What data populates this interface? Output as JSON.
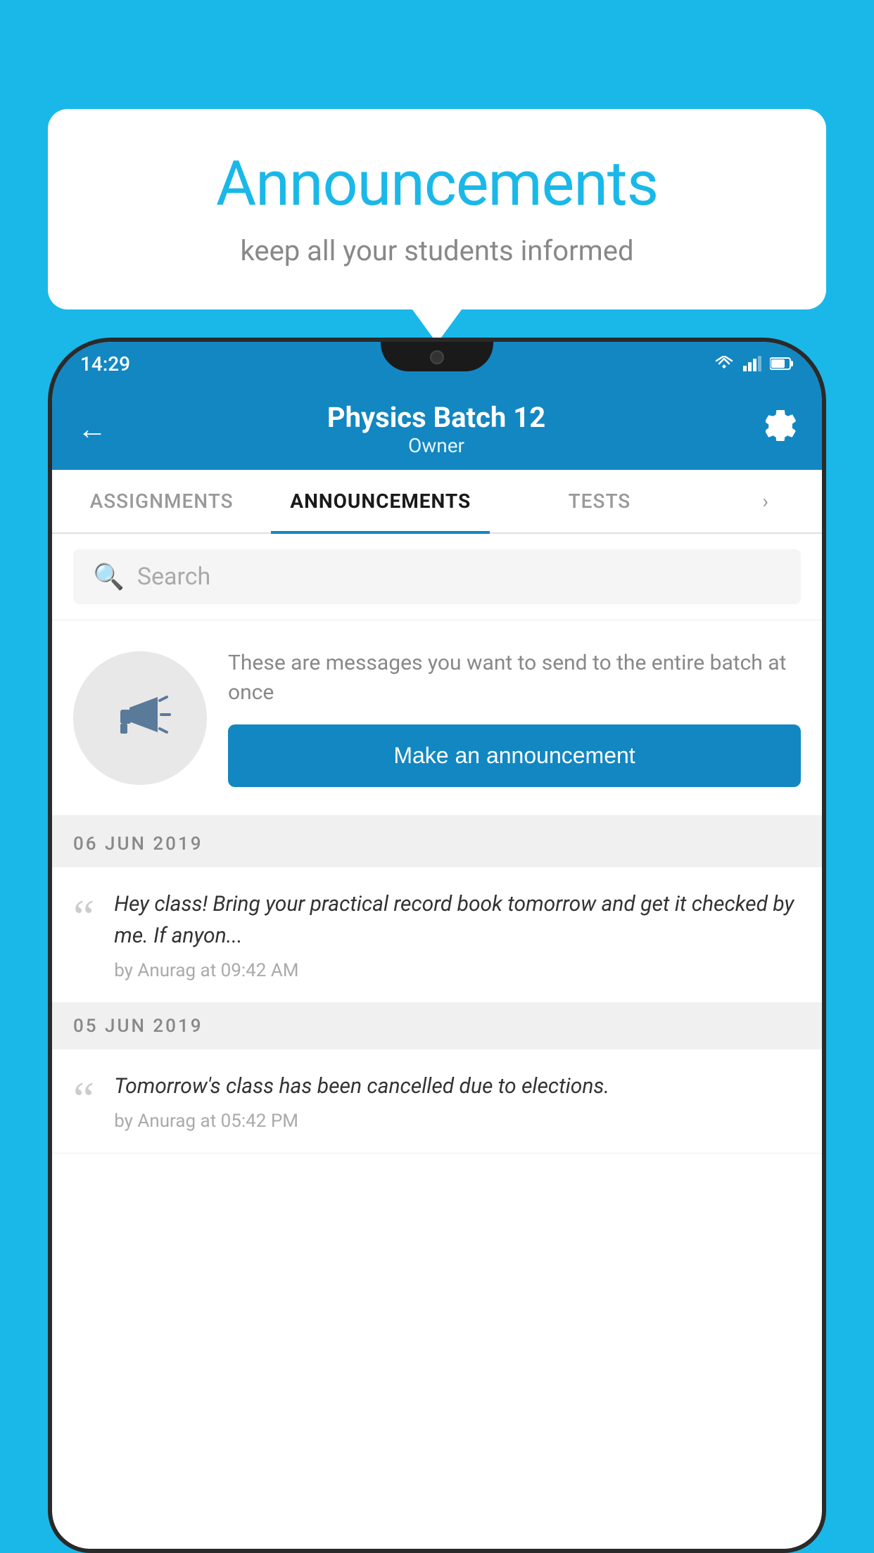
{
  "background_color": "#1ab8e8",
  "speech_bubble": {
    "title": "Announcements",
    "subtitle": "keep all your students informed"
  },
  "phone": {
    "status_bar": {
      "time": "14:29"
    },
    "header": {
      "back_label": "←",
      "batch_name": "Physics Batch 12",
      "owner_label": "Owner",
      "settings_icon": "gear"
    },
    "tabs": [
      {
        "label": "ASSIGNMENTS",
        "active": false
      },
      {
        "label": "ANNOUNCEMENTS",
        "active": true
      },
      {
        "label": "TESTS",
        "active": false
      }
    ],
    "search": {
      "placeholder": "Search"
    },
    "promo": {
      "description": "These are messages you want to send to the entire batch at once",
      "button_label": "Make an announcement"
    },
    "announcements": [
      {
        "date": "06  JUN  2019",
        "text": "Hey class! Bring your practical record book tomorrow and get it checked by me. If anyon...",
        "meta": "by Anurag at 09:42 AM"
      },
      {
        "date": "05  JUN  2019",
        "text": "Tomorrow's class has been cancelled due to elections.",
        "meta": "by Anurag at 05:42 PM"
      }
    ]
  }
}
